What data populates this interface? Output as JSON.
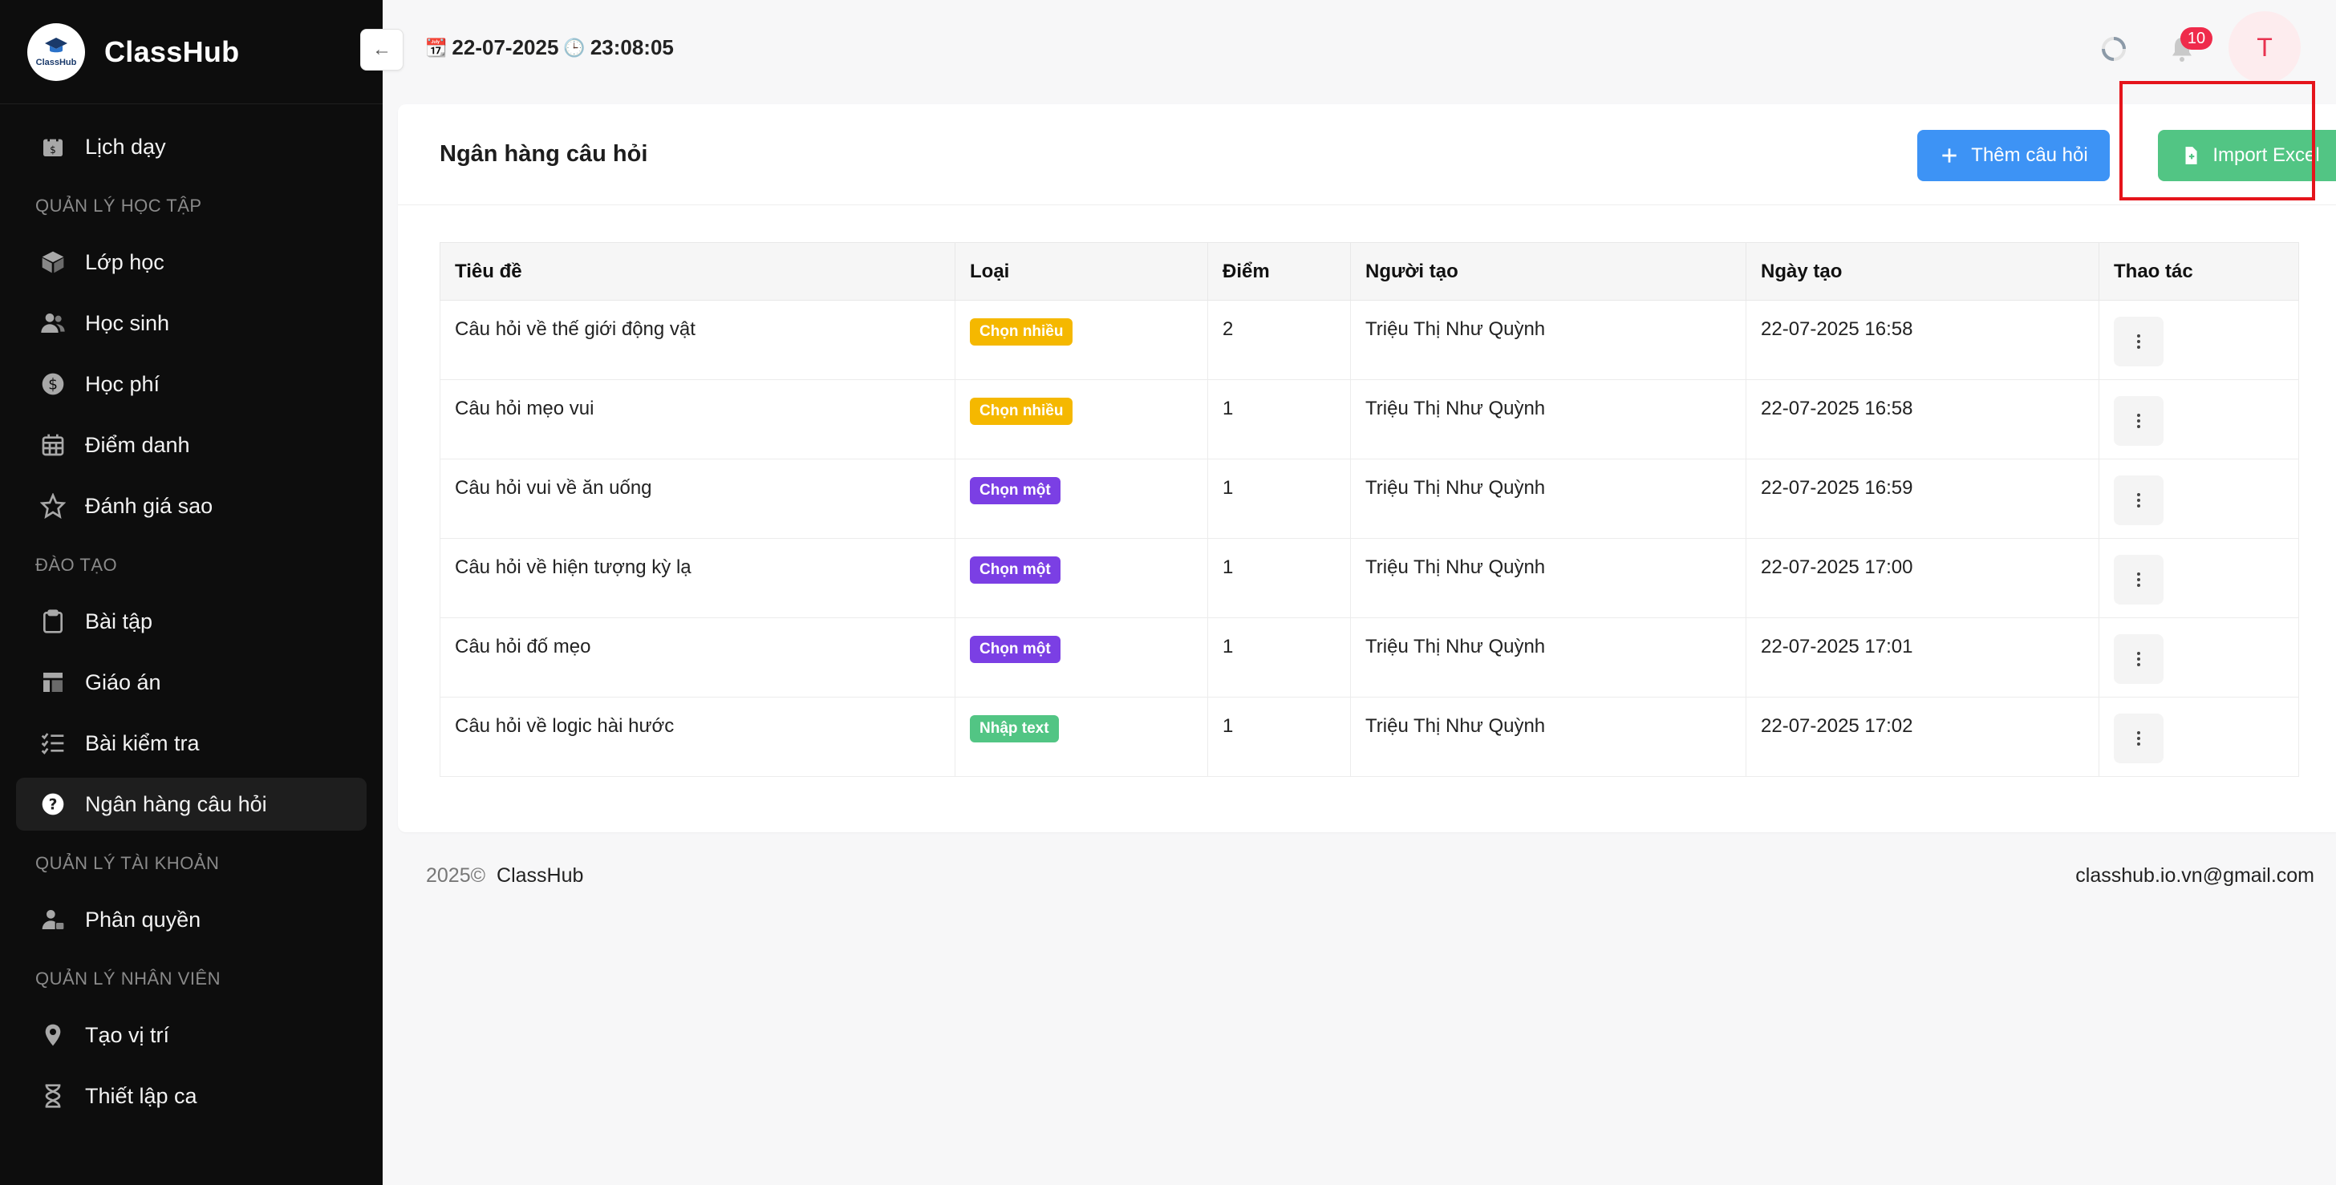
{
  "app": {
    "name": "ClassHub",
    "logo_text": "ClassHub"
  },
  "header": {
    "date": "22-07-2025",
    "time": "23:08:05",
    "notification_count": "10",
    "avatar_initial": "T"
  },
  "sidebar": {
    "top_item": "Lịch dạy",
    "sections": [
      {
        "label": "QUẢN LÝ HỌC TẬP",
        "items": [
          "Lớp học",
          "Học sinh",
          "Học phí",
          "Điểm danh",
          "Đánh giá sao"
        ]
      },
      {
        "label": "ĐÀO TẠO",
        "items": [
          "Bài tập",
          "Giáo án",
          "Bài kiểm tra",
          "Ngân hàng câu hỏi"
        ]
      },
      {
        "label": "QUẢN LÝ TÀI KHOẢN",
        "items": [
          "Phân quyền"
        ]
      },
      {
        "label": "QUẢN LÝ NHÂN VIÊN",
        "items": [
          "Tạo vị trí",
          "Thiết lập ca"
        ]
      }
    ]
  },
  "page": {
    "title": "Ngân hàng câu hỏi",
    "add_button": "Thêm câu hỏi",
    "import_button": "Import Excel"
  },
  "table": {
    "columns": [
      "Tiêu đề",
      "Loại",
      "Điểm",
      "Người tạo",
      "Ngày tạo",
      "Thao tác"
    ],
    "rows": [
      {
        "title": "Câu hỏi về thế giới động vật",
        "type": "Chọn nhiều",
        "type_color": "#f5b800",
        "score": "2",
        "creator": "Triệu Thị Như Quỳnh",
        "created": "22-07-2025 16:58"
      },
      {
        "title": "Câu hỏi mẹo vui",
        "type": "Chọn nhiều",
        "type_color": "#f5b800",
        "score": "1",
        "creator": "Triệu Thị Như Quỳnh",
        "created": "22-07-2025 16:58"
      },
      {
        "title": "Câu hỏi vui về ăn uống",
        "type": "Chọn một",
        "type_color": "#7b3fe4",
        "score": "1",
        "creator": "Triệu Thị Như Quỳnh",
        "created": "22-07-2025 16:59"
      },
      {
        "title": "Câu hỏi về hiện tượng kỳ lạ",
        "type": "Chọn một",
        "type_color": "#7b3fe4",
        "score": "1",
        "creator": "Triệu Thị Như Quỳnh",
        "created": "22-07-2025 17:00"
      },
      {
        "title": "Câu hỏi đố mẹo",
        "type": "Chọn một",
        "type_color": "#7b3fe4",
        "score": "1",
        "creator": "Triệu Thị Như Quỳnh",
        "created": "22-07-2025 17:01"
      },
      {
        "title": "Câu hỏi về logic hài hước",
        "type": "Nhập text",
        "type_color": "#52c584",
        "score": "1",
        "creator": "Triệu Thị Như Quỳnh",
        "created": "22-07-2025 17:02"
      }
    ]
  },
  "footer": {
    "year": "2025©",
    "brand": "ClassHub",
    "email": "classhub.io.vn@gmail.com"
  },
  "colors": {
    "sidebar_bg": "#0d0d0d",
    "primary": "#3d93f5",
    "success": "#52c584",
    "highlight": "#e5141b"
  }
}
